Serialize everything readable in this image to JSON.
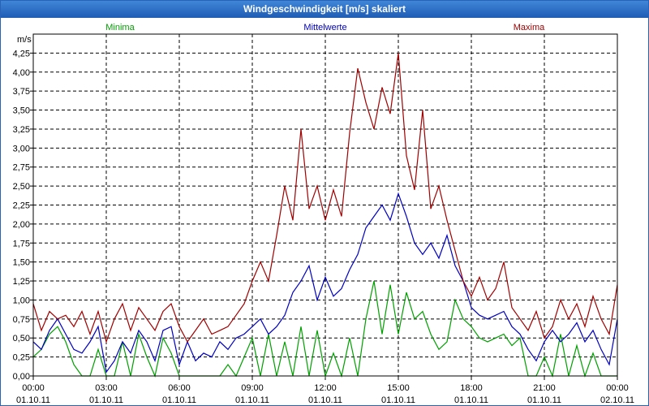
{
  "window": {
    "title": "Windgeschwindigkeit [m/s] skaliert"
  },
  "chart_data": {
    "type": "line",
    "title": "Windgeschwindigkeit [m/s] skaliert",
    "ylabel": "m/s",
    "ylim": [
      0,
      4.5
    ],
    "yticks": [
      0,
      0.25,
      0.5,
      0.75,
      1.0,
      1.25,
      1.5,
      1.75,
      2.0,
      2.25,
      2.5,
      2.75,
      3.0,
      3.25,
      3.5,
      3.75,
      4.0,
      4.25
    ],
    "ytick_labels": [
      "0,00",
      "0,25",
      "0,50",
      "0,75",
      "1,00",
      "1,25",
      "1,50",
      "1,75",
      "2,00",
      "2,25",
      "2,50",
      "2,75",
      "3,00",
      "3,25",
      "3,50",
      "3,75",
      "4,00",
      "4,25"
    ],
    "xlim": [
      "2011-10-01 00:00",
      "2011-10-02 00:00"
    ],
    "xticks": [
      {
        "time": "00:00",
        "date": "01.10.11"
      },
      {
        "time": "03:00",
        "date": "01.10.11"
      },
      {
        "time": "06:00",
        "date": "01.10.11"
      },
      {
        "time": "09:00",
        "date": "01.10.11"
      },
      {
        "time": "12:00",
        "date": "01.10.11"
      },
      {
        "time": "15:00",
        "date": "01.10.11"
      },
      {
        "time": "18:00",
        "date": "01.10.11"
      },
      {
        "time": "21:00",
        "date": "01.10.11"
      },
      {
        "time": "00:00",
        "date": "02.10.11"
      }
    ],
    "grid": true,
    "legend_position": "top",
    "series": [
      {
        "name": "Minima",
        "color": "#00a000",
        "x": [
          "00:00",
          "00:20",
          "00:40",
          "01:00",
          "01:20",
          "01:40",
          "02:00",
          "02:20",
          "02:40",
          "03:00",
          "03:20",
          "03:40",
          "04:00",
          "04:20",
          "04:40",
          "05:00",
          "05:20",
          "05:40",
          "06:00",
          "06:20",
          "06:40",
          "07:00",
          "07:20",
          "07:40",
          "08:00",
          "08:20",
          "08:40",
          "09:00",
          "09:20",
          "09:40",
          "10:00",
          "10:20",
          "10:40",
          "11:00",
          "11:20",
          "11:40",
          "12:00",
          "12:20",
          "12:40",
          "13:00",
          "13:20",
          "13:40",
          "14:00",
          "14:20",
          "14:40",
          "15:00",
          "15:20",
          "15:40",
          "16:00",
          "16:20",
          "16:40",
          "17:00",
          "17:20",
          "17:40",
          "18:00",
          "18:20",
          "18:40",
          "19:00",
          "19:20",
          "19:40",
          "20:00",
          "20:20",
          "20:40",
          "21:00",
          "21:20",
          "21:40",
          "22:00",
          "22:20",
          "22:40",
          "23:00",
          "23:20",
          "23:40",
          "24:00"
        ],
        "values": [
          0.25,
          0.35,
          0.55,
          0.65,
          0.45,
          0.15,
          0.0,
          0.0,
          0.35,
          0.0,
          0.0,
          0.45,
          0.0,
          0.55,
          0.25,
          0.0,
          0.5,
          0.3,
          0.0,
          0.0,
          0.0,
          0.0,
          0.0,
          0.0,
          0.15,
          0.0,
          0.25,
          0.5,
          0.0,
          0.55,
          0.0,
          0.45,
          0.0,
          0.65,
          0.0,
          0.6,
          0.0,
          0.3,
          0.0,
          0.5,
          0.0,
          0.75,
          1.25,
          0.55,
          1.2,
          0.55,
          1.1,
          0.75,
          0.85,
          0.55,
          0.35,
          0.45,
          1.0,
          0.75,
          0.65,
          0.5,
          0.45,
          0.5,
          0.55,
          0.4,
          0.5,
          0.0,
          0.0,
          0.25,
          0.0,
          0.55,
          0.0,
          0.4,
          0.0,
          0.3,
          0.0,
          0.0,
          0.0
        ]
      },
      {
        "name": "Mittelwerte",
        "color": "#0000c0",
        "x": [
          "00:00",
          "00:20",
          "00:40",
          "01:00",
          "01:20",
          "01:40",
          "02:00",
          "02:20",
          "02:40",
          "03:00",
          "03:20",
          "03:40",
          "04:00",
          "04:20",
          "04:40",
          "05:00",
          "05:20",
          "05:40",
          "06:00",
          "06:20",
          "06:40",
          "07:00",
          "07:20",
          "07:40",
          "08:00",
          "08:20",
          "08:40",
          "09:00",
          "09:20",
          "09:40",
          "10:00",
          "10:20",
          "10:40",
          "11:00",
          "11:20",
          "11:40",
          "12:00",
          "12:20",
          "12:40",
          "13:00",
          "13:20",
          "13:40",
          "14:00",
          "14:20",
          "14:40",
          "15:00",
          "15:20",
          "15:40",
          "16:00",
          "16:20",
          "16:40",
          "17:00",
          "17:20",
          "17:40",
          "18:00",
          "18:20",
          "18:40",
          "19:00",
          "19:20",
          "19:40",
          "20:00",
          "20:20",
          "20:40",
          "21:00",
          "21:20",
          "21:40",
          "22:00",
          "22:20",
          "22:40",
          "23:00",
          "23:20",
          "23:40",
          "24:00"
        ],
        "values": [
          0.45,
          0.35,
          0.6,
          0.75,
          0.55,
          0.35,
          0.3,
          0.45,
          0.65,
          0.05,
          0.2,
          0.45,
          0.3,
          0.6,
          0.45,
          0.2,
          0.6,
          0.65,
          0.15,
          0.45,
          0.2,
          0.3,
          0.25,
          0.45,
          0.35,
          0.5,
          0.55,
          0.65,
          0.75,
          0.55,
          0.65,
          0.8,
          1.1,
          1.25,
          1.45,
          1.0,
          1.3,
          1.05,
          1.15,
          1.4,
          1.6,
          1.95,
          2.1,
          2.25,
          2.05,
          2.4,
          2.1,
          1.75,
          1.6,
          1.75,
          1.55,
          1.85,
          1.45,
          1.25,
          0.9,
          0.8,
          0.75,
          0.8,
          0.85,
          0.65,
          0.55,
          0.35,
          0.2,
          0.45,
          0.6,
          0.45,
          0.55,
          0.7,
          0.45,
          0.6,
          0.35,
          0.15,
          0.75
        ]
      },
      {
        "name": "Maxima",
        "color": "#a00000",
        "x": [
          "00:00",
          "00:20",
          "00:40",
          "01:00",
          "01:20",
          "01:40",
          "02:00",
          "02:20",
          "02:40",
          "03:00",
          "03:20",
          "03:40",
          "04:00",
          "04:20",
          "04:40",
          "05:00",
          "05:20",
          "05:40",
          "06:00",
          "06:20",
          "06:40",
          "07:00",
          "07:20",
          "07:40",
          "08:00",
          "08:20",
          "08:40",
          "09:00",
          "09:20",
          "09:40",
          "10:00",
          "10:20",
          "10:40",
          "11:00",
          "11:20",
          "11:40",
          "12:00",
          "12:20",
          "12:40",
          "13:00",
          "13:20",
          "13:40",
          "14:00",
          "14:20",
          "14:40",
          "15:00",
          "15:20",
          "15:40",
          "16:00",
          "16:20",
          "16:40",
          "17:00",
          "17:20",
          "17:40",
          "18:00",
          "18:20",
          "18:40",
          "19:00",
          "19:20",
          "19:40",
          "20:00",
          "20:20",
          "20:40",
          "21:00",
          "21:20",
          "21:40",
          "22:00",
          "22:20",
          "22:40",
          "23:00",
          "23:20",
          "23:40",
          "24:00"
        ],
        "values": [
          0.95,
          0.6,
          0.85,
          0.75,
          0.8,
          0.65,
          0.85,
          0.55,
          0.85,
          0.45,
          0.75,
          0.95,
          0.6,
          0.9,
          0.75,
          0.6,
          0.85,
          0.95,
          0.65,
          0.45,
          0.6,
          0.75,
          0.55,
          0.6,
          0.65,
          0.8,
          0.95,
          1.25,
          1.5,
          1.25,
          1.85,
          2.5,
          2.05,
          3.25,
          2.2,
          2.5,
          2.05,
          2.45,
          2.1,
          3.2,
          4.05,
          3.6,
          3.25,
          3.8,
          3.45,
          4.25,
          2.9,
          2.45,
          3.5,
          2.2,
          2.5,
          2.05,
          1.65,
          1.25,
          1.05,
          1.3,
          1.0,
          1.15,
          1.5,
          0.9,
          0.75,
          0.6,
          0.85,
          0.5,
          0.65,
          1.0,
          0.75,
          0.95,
          0.65,
          1.05,
          0.75,
          0.55,
          1.2
        ]
      }
    ]
  }
}
